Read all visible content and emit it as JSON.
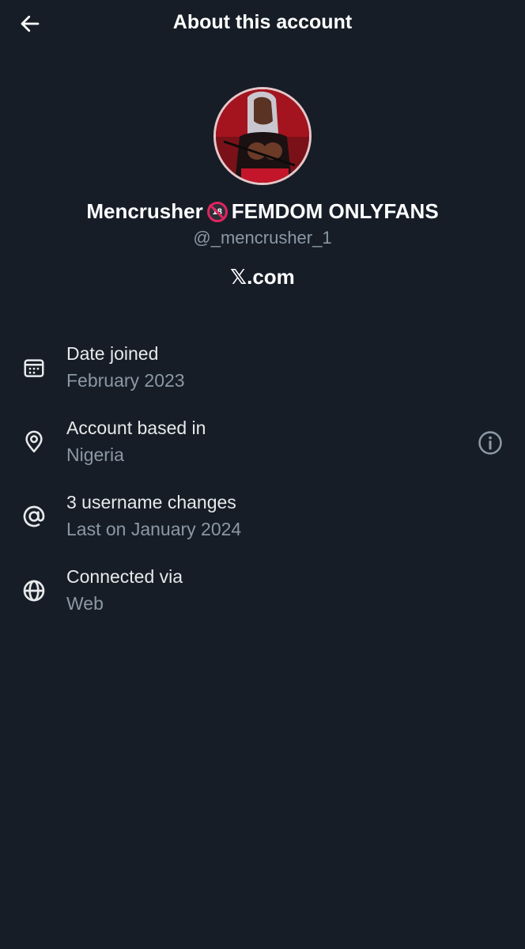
{
  "header": {
    "title": "About this account",
    "back_icon": "arrow-left-icon"
  },
  "profile": {
    "name_part1": "Mencrusher",
    "badge_text": "18",
    "name_part2": "FEMDOM ONLYFANS",
    "handle": "@_mencrusher_1",
    "site": "𝕏.com",
    "avatar_icon": "profile-photo",
    "avatar_border_color": "#e6c7c9"
  },
  "info": [
    {
      "icon": "calendar-icon",
      "title": "Date joined",
      "value": "February 2023"
    },
    {
      "icon": "location-pin-icon",
      "title": "Account based in",
      "value": "Nigeria"
    },
    {
      "icon": "at-sign-icon",
      "title": "3 username changes",
      "value": "Last on January 2024"
    },
    {
      "icon": "globe-icon",
      "title": "Connected via",
      "value": "Web"
    }
  ],
  "colors": {
    "background": "#161d27",
    "primary_text": "#e7e9ea",
    "secondary_text": "#8b98a5",
    "badge_red": "#e0245e"
  }
}
